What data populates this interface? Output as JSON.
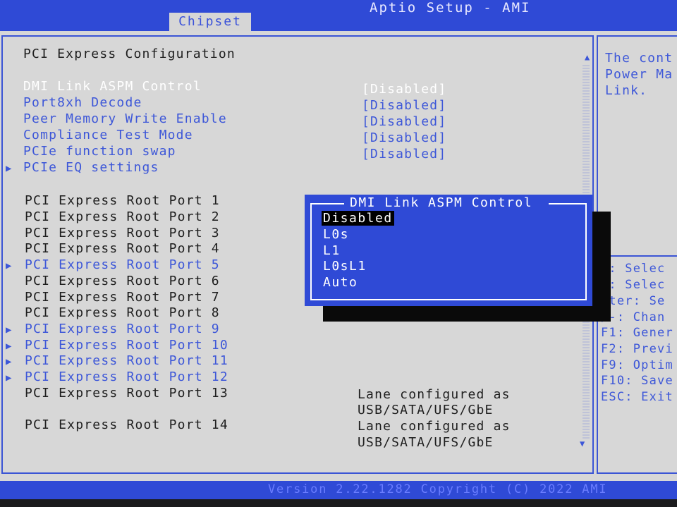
{
  "app": {
    "title": "Aptio Setup - AMI",
    "tab": "Chipset"
  },
  "page": {
    "heading": "PCI Express Configuration"
  },
  "settings": [
    {
      "label": "DMI Link ASPM Control",
      "value": "[Disabled]"
    },
    {
      "label": "Port8xh Decode",
      "value": "[Disabled]"
    },
    {
      "label": "Peer Memory Write Enable",
      "value": "[Disabled]"
    },
    {
      "label": "Compliance Test Mode",
      "value": "[Disabled]"
    },
    {
      "label": "PCIe function swap",
      "value": "[Disabled]"
    },
    {
      "label": "PCIe EQ settings"
    }
  ],
  "root_ports": [
    "PCI Express Root Port 1",
    "PCI Express Root Port 2",
    "PCI Express Root Port 3",
    "PCI Express Root Port 4",
    "PCI Express Root Port 5",
    "PCI Express Root Port 6",
    "PCI Express Root Port 7",
    "PCI Express Root Port 8",
    "PCI Express Root Port 9",
    "PCI Express Root Port 10",
    "PCI Express Root Port 11",
    "PCI Express Root Port 12",
    "PCI Express Root Port 13",
    "PCI Express Root Port 14"
  ],
  "port_notes": {
    "port13_line1": "Lane configured as",
    "port13_line2": "USB/SATA/UFS/GbE",
    "port14_line1": "Lane configured as",
    "port14_line2": "USB/SATA/UFS/GbE"
  },
  "submenu_arrow": "▶",
  "popup": {
    "title": "DMI Link ASPM Control",
    "options": [
      "Disabled",
      "L0s",
      "L1",
      "L0sL1",
      "Auto"
    ],
    "selected": "Disabled"
  },
  "help": {
    "line1": "The cont",
    "line2": "Power Ma",
    "line3": "Link."
  },
  "keys": {
    "k1": "↔: Selec",
    "k2": "↕: Selec",
    "k3": "nter: Se",
    "k4": "/-: Chan",
    "k5": "F1: Gener",
    "k6": "F2: Previ",
    "k7": "F9: Optim",
    "k8": "F10: Save",
    "k9": "ESC: Exit"
  },
  "footer": {
    "text": "Version 2.22.1282 Copyright (C) 2022 AMI"
  },
  "colors": {
    "bios_blue": "#2f4ad6",
    "panel_gray": "#d7d7d7",
    "link_blue": "#3d57d8"
  }
}
